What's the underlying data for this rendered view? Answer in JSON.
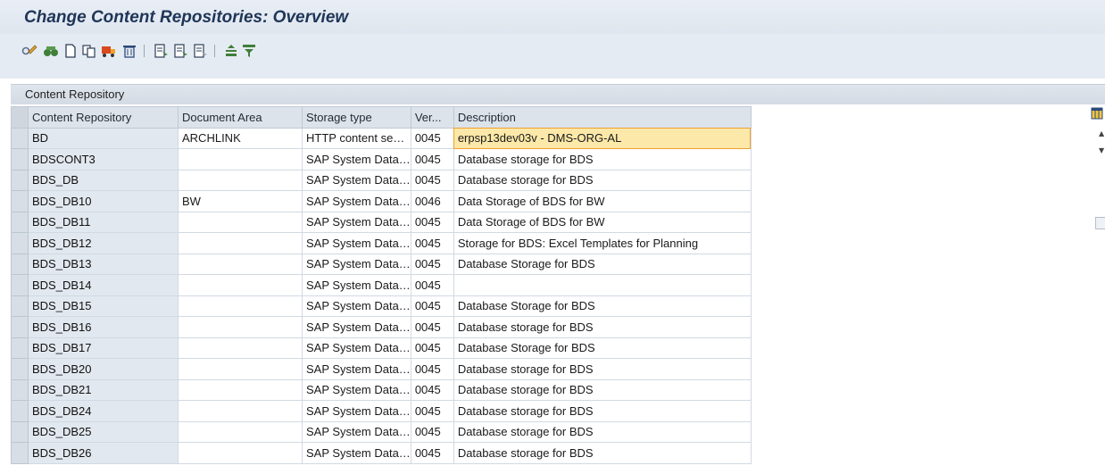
{
  "window": {
    "title": "Change Content Repositories: Overview"
  },
  "toolbar": {
    "buttons": [
      {
        "icon": "display-change-icon"
      },
      {
        "icon": "find-icon"
      },
      {
        "icon": "new-entries-icon"
      },
      {
        "icon": "copy-icon"
      },
      {
        "icon": "transport-icon"
      },
      {
        "icon": "delete-icon"
      },
      {
        "icon": "select-all-icon"
      },
      {
        "icon": "select-block-icon"
      },
      {
        "icon": "deselect-all-icon"
      },
      {
        "icon": "sort-ascending-icon"
      },
      {
        "icon": "filter-icon"
      }
    ]
  },
  "panel": {
    "title": "Content Repository"
  },
  "table": {
    "columns": [
      "Content Repository",
      "Document Area",
      "Storage type",
      "Ver...",
      "Description"
    ],
    "rows": [
      [
        "BD",
        "ARCHLINK",
        "HTTP content se…",
        "0045",
        "erpsp13dev03v - DMS-ORG-AL"
      ],
      [
        "BDSCONT3",
        "",
        "SAP System Data…",
        "0045",
        "Database storage for BDS"
      ],
      [
        "BDS_DB",
        "",
        "SAP System Data…",
        "0045",
        "Database storage for BDS"
      ],
      [
        "BDS_DB10",
        "BW",
        "SAP System Data…",
        "0046",
        "Data Storage of BDS for BW"
      ],
      [
        "BDS_DB11",
        "",
        "SAP System Data…",
        "0045",
        "Data Storage of BDS for BW"
      ],
      [
        "BDS_DB12",
        "",
        "SAP System Data…",
        "0045",
        "Storage for BDS: Excel Templates for Planning"
      ],
      [
        "BDS_DB13",
        "",
        "SAP System Data…",
        "0045",
        "Database Storage for BDS"
      ],
      [
        "BDS_DB14",
        "",
        "SAP System Data…",
        "0045",
        ""
      ],
      [
        "BDS_DB15",
        "",
        "SAP System Data…",
        "0045",
        "Database Storage for BDS"
      ],
      [
        "BDS_DB16",
        "",
        "SAP System Data…",
        "0045",
        "Database storage for BDS"
      ],
      [
        "BDS_DB17",
        "",
        "SAP System Data…",
        "0045",
        "Database Storage for BDS"
      ],
      [
        "BDS_DB20",
        "",
        "SAP System Data…",
        "0045",
        "Database storage for BDS"
      ],
      [
        "BDS_DB21",
        "",
        "SAP System Data…",
        "0045",
        "Database storage for BDS"
      ],
      [
        "BDS_DB24",
        "",
        "SAP System Data…",
        "0045",
        "Database storage for BDS"
      ],
      [
        "BDS_DB25",
        "",
        "SAP System Data…",
        "0045",
        "Database storage for BDS"
      ],
      [
        "BDS_DB26",
        "",
        "SAP System Data…",
        "0045",
        "Database storage for BDS"
      ]
    ],
    "selected_row": 0,
    "focused_cell": "Description"
  },
  "side": {
    "icons": [
      "column-settings-icon",
      "scroll-up-icon",
      "scroll-down-icon"
    ]
  }
}
